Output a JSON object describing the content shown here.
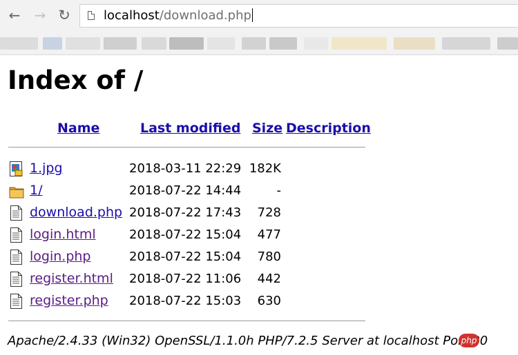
{
  "browser": {
    "url_host": "localhost",
    "url_path": "/download.php",
    "bookmark_colors": [
      "#dcdcdc",
      "#c7d3e3",
      "#e0e0e0",
      "#cfcfcf",
      "#d9d9d9",
      "#bdbdbd",
      "#e4e4e4",
      "#d2d2d2",
      "#c9c9c9",
      "#e8e8e8",
      "#f0e6c8",
      "#eadfc4",
      "#d6d6d6",
      "#cdcdcd"
    ]
  },
  "page": {
    "title": "Index of /",
    "columns": [
      "Name",
      "Last modified",
      "Size",
      "Description"
    ],
    "files": [
      {
        "name": "1.jpg",
        "modified": "2018-03-11 22:29",
        "size": "182K",
        "icon": "image-icon",
        "visited": false
      },
      {
        "name": "1/",
        "modified": "2018-07-22 14:44",
        "size": "-",
        "icon": "folder-icon",
        "visited": false
      },
      {
        "name": "download.php",
        "modified": "2018-07-22 17:43",
        "size": "728",
        "icon": "file-icon",
        "visited": false
      },
      {
        "name": "login.html",
        "modified": "2018-07-22 15:04",
        "size": "477",
        "icon": "file-icon",
        "visited": true
      },
      {
        "name": "login.php",
        "modified": "2018-07-22 15:04",
        "size": "780",
        "icon": "file-icon",
        "visited": true
      },
      {
        "name": "register.html",
        "modified": "2018-07-22 11:06",
        "size": "442",
        "icon": "file-icon",
        "visited": true
      },
      {
        "name": "register.php",
        "modified": "2018-07-22 15:03",
        "size": "630",
        "icon": "file-icon",
        "visited": true
      }
    ],
    "server_signature": "Apache/2.4.33 (Win32) OpenSSL/1.1.0h PHP/7.2.5 Server at localhost Port 80",
    "watermark": "php"
  },
  "colors": {
    "link": "#1a0dab",
    "visited": "#5a1b83",
    "watermark": "#d0322e"
  }
}
